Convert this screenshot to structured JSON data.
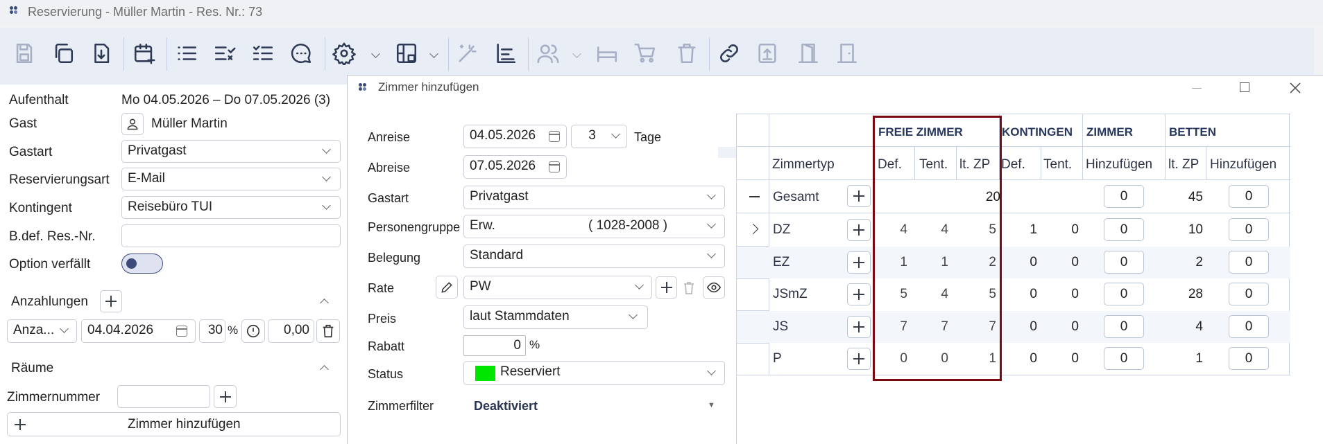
{
  "window": {
    "title": "Reservierung - Müller Martin - Res. Nr.: 73"
  },
  "toolbar": {
    "icons": [
      "save-icon",
      "copy-icon",
      "download-icon",
      "calendar-add-icon",
      "list-icon",
      "list-check-icon",
      "checklist-icon",
      "chat-icon",
      "gear-icon",
      "chevron-down-icon",
      "room-plan-icon",
      "chevron-down-icon",
      "magic-wand-icon",
      "chart-icon",
      "users-icon",
      "chevron-down-icon",
      "bed-icon",
      "cart-icon",
      "trash-icon",
      "link-icon",
      "upload-icon",
      "door-open-icon",
      "door-icon"
    ]
  },
  "left": {
    "aufenthalt_label": "Aufenthalt",
    "aufenthalt_value": "Mo 04.05.2026 – Do 07.05.2026 (3)",
    "gast_label": "Gast",
    "gast_value": "Müller Martin",
    "gastart_label": "Gastart",
    "gastart_value": "Privatgast",
    "resart_label": "Reservierungsart",
    "resart_value": "E-Mail",
    "kontingent_label": "Kontingent",
    "kontingent_value": "Reisebüro TUI",
    "bdef_label": "B.def. Res.-Nr.",
    "bdef_value": "",
    "option_label": "Option verfällt",
    "anzahlungen_label": "Anzahlungen",
    "anz_type": "Anza...",
    "anz_date": "04.04.2026",
    "anz_percent": "30",
    "anz_percent_unit": "%",
    "anz_amount": "0,00",
    "raeume_label": "Räume",
    "zimmernummer_label": "Zimmernummer",
    "zimmernummer_value": "",
    "zimmer_hinzufuegen_label": "Zimmer hinzufügen"
  },
  "dialog": {
    "title": "Zimmer hinzufügen",
    "anreise_label": "Anreise",
    "anreise_value": "04.05.2026",
    "nights_value": "3",
    "tage_label": "Tage",
    "abreise_label": "Abreise",
    "abreise_value": "07.05.2026",
    "gastart_label": "Gastart",
    "gastart_value": "Privatgast",
    "personengruppe_label": "Personengruppe",
    "personengruppe_value": "Erw.",
    "personengruppe_code": "( 1028-2008 )",
    "belegung_label": "Belegung",
    "belegung_value": "Standard",
    "rate_label": "Rate",
    "rate_value": "PW",
    "preis_label": "Preis",
    "preis_value": "laut Stammdaten",
    "rabatt_label": "Rabatt",
    "rabatt_value": "0",
    "rabatt_unit": "%",
    "status_label": "Status",
    "status_value": "Reserviert",
    "status_color": "#00e600",
    "zimmerfilter_label": "Zimmerfilter",
    "zimmerfilter_value": "Deaktiviert"
  },
  "grid": {
    "groups": {
      "freie": "FREIE ZIMMER",
      "kontingen": "KONTINGEN",
      "zimmer": "ZIMMER",
      "betten": "BETTEN"
    },
    "columns": {
      "zimmertyp": "Zimmertyp",
      "def": "Def.",
      "tent": "Tent.",
      "ltzp": "lt. ZP",
      "kdef": "Def.",
      "ktent": "Tent.",
      "zhinzu": "Hinzufügen",
      "bltzp": "lt. ZP",
      "bhinzu": "Hinzufügen"
    },
    "total": {
      "label": "Gesamt",
      "ltzp": "20",
      "zimmer_add": "0",
      "betten_ltzp": "45",
      "betten_add": "0"
    },
    "rows": [
      {
        "type": "DZ",
        "def": "4",
        "tent": "4",
        "ltzp": "5",
        "kdef": "1",
        "ktent": "0",
        "zadd": "0",
        "bltzp": "10",
        "badd": "0"
      },
      {
        "type": "EZ",
        "def": "1",
        "tent": "1",
        "ltzp": "2",
        "kdef": "0",
        "ktent": "0",
        "zadd": "0",
        "bltzp": "2",
        "badd": "0"
      },
      {
        "type": "JSmZ",
        "def": "5",
        "tent": "4",
        "ltzp": "5",
        "kdef": "0",
        "ktent": "0",
        "zadd": "0",
        "bltzp": "28",
        "badd": "0"
      },
      {
        "type": "JS",
        "def": "7",
        "tent": "7",
        "ltzp": "7",
        "kdef": "0",
        "ktent": "0",
        "zadd": "0",
        "bltzp": "4",
        "badd": "0"
      },
      {
        "type": "P",
        "def": "0",
        "tent": "0",
        "ltzp": "1",
        "kdef": "0",
        "ktent": "0",
        "zadd": "0",
        "bltzp": "1",
        "badd": "0"
      }
    ],
    "highlight_color": "#7a0a12"
  }
}
